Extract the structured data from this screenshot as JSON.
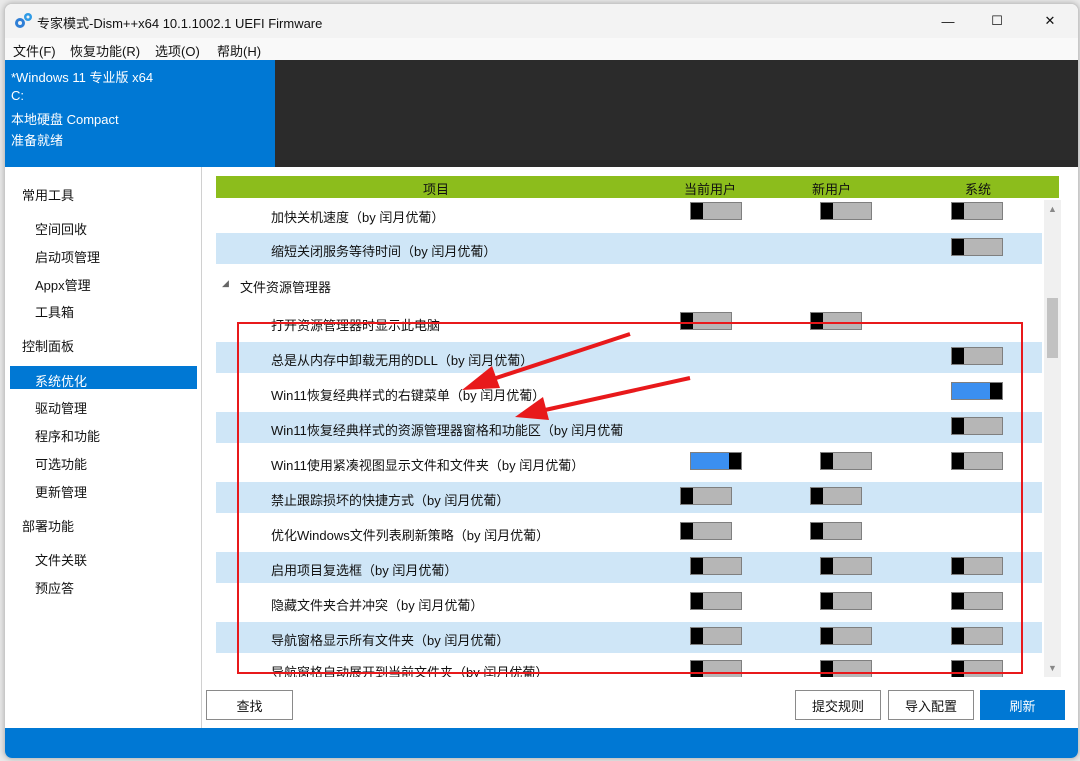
{
  "window": {
    "title": "专家模式-Dism++x64 10.1.1002.1 UEFI Firmware",
    "minimize": "—",
    "maximize": "☐",
    "close": "✕"
  },
  "menu": [
    "文件(F)",
    "恢复功能(R)",
    "选项(O)",
    "帮助(H)"
  ],
  "info": {
    "os": "*Windows 11 专业版 x64",
    "drive": "C:",
    "disk": "本地硬盘 Compact",
    "status": "准备就绪"
  },
  "sidebar": {
    "groups": [
      {
        "label": "常用工具",
        "items": [
          "空间回收",
          "启动项管理",
          "Appx管理",
          "工具箱"
        ]
      },
      {
        "label": "控制面板",
        "items": [
          "系统优化",
          "驱动管理",
          "程序和功能",
          "可选功能",
          "更新管理"
        ]
      },
      {
        "label": "部署功能",
        "items": [
          "文件关联",
          "预应答"
        ]
      }
    ],
    "selected": "系统优化"
  },
  "table": {
    "headers": [
      "项目",
      "当前用户",
      "新用户",
      "系统"
    ],
    "rows": [
      {
        "label": "加快关机速度（by 闰月优葡）",
        "cur": "off",
        "new": "off",
        "sys": "off"
      },
      {
        "label": "缩短关闭服务等待时间（by 闰月优葡）",
        "cur": null,
        "new": null,
        "sys": "off"
      },
      {
        "label": "文件资源管理器",
        "section": true
      },
      {
        "label": "打开资源管理器时显示此电脑",
        "cur": "off",
        "new": "off",
        "sys": null
      },
      {
        "label": "总是从内存中卸载无用的DLL（by 闰月优葡）",
        "cur": null,
        "new": null,
        "sys": "off"
      },
      {
        "label": "Win11恢复经典样式的右键菜单（by 闰月优葡）",
        "cur": null,
        "new": null,
        "sys": "on"
      },
      {
        "label": "Win11恢复经典样式的资源管理器窗格和功能区（by 闰月优葡",
        "cur": null,
        "new": null,
        "sys": "off"
      },
      {
        "label": "Win11使用紧凑视图显示文件和文件夹（by 闰月优葡）",
        "cur": "on",
        "new": "off",
        "sys": "off"
      },
      {
        "label": "禁止跟踪损坏的快捷方式（by 闰月优葡）",
        "cur": "off",
        "new": "off",
        "sys": null
      },
      {
        "label": "优化Windows文件列表刷新策略（by 闰月优葡）",
        "cur": "off",
        "new": "off",
        "sys": null
      },
      {
        "label": "启用项目复选框（by 闰月优葡）",
        "cur": "off",
        "new": "off",
        "sys": "off"
      },
      {
        "label": "隐藏文件夹合并冲突（by 闰月优葡）",
        "cur": "off",
        "new": "off",
        "sys": "off"
      },
      {
        "label": "导航窗格显示所有文件夹（by 闰月优葡）",
        "cur": "off",
        "new": "off",
        "sys": "off"
      },
      {
        "label": "导航窗格自动展开到当前文件夹（by 闰月优葡）",
        "cur": "off",
        "new": "off",
        "sys": "off"
      }
    ]
  },
  "buttons": {
    "find": "查找",
    "submit_rule": "提交规则",
    "import_config": "导入配置",
    "refresh": "刷新"
  },
  "colors": {
    "accent": "#0078d4",
    "header": "#8cbd1c",
    "row_alt": "#cfe6f7",
    "annotation": "#e8191b"
  }
}
